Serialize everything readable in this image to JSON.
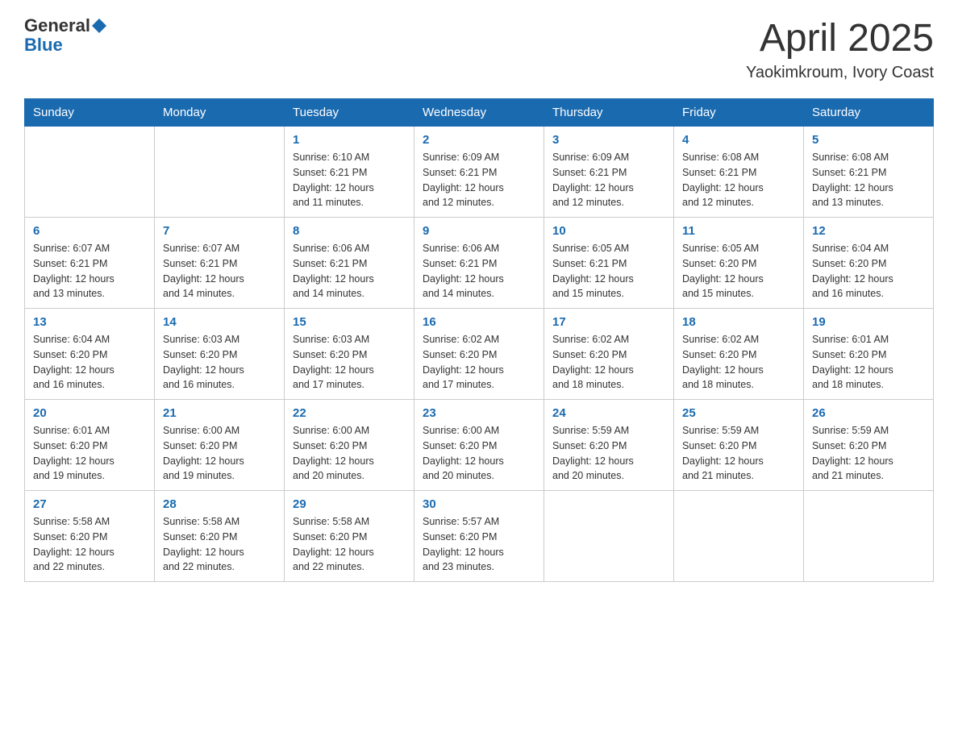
{
  "logo": {
    "general": "General",
    "blue": "Blue"
  },
  "title": "April 2025",
  "subtitle": "Yaokimkroum, Ivory Coast",
  "weekdays": [
    "Sunday",
    "Monday",
    "Tuesday",
    "Wednesday",
    "Thursday",
    "Friday",
    "Saturday"
  ],
  "weeks": [
    [
      {
        "day": "",
        "info": ""
      },
      {
        "day": "",
        "info": ""
      },
      {
        "day": "1",
        "info": "Sunrise: 6:10 AM\nSunset: 6:21 PM\nDaylight: 12 hours\nand 11 minutes."
      },
      {
        "day": "2",
        "info": "Sunrise: 6:09 AM\nSunset: 6:21 PM\nDaylight: 12 hours\nand 12 minutes."
      },
      {
        "day": "3",
        "info": "Sunrise: 6:09 AM\nSunset: 6:21 PM\nDaylight: 12 hours\nand 12 minutes."
      },
      {
        "day": "4",
        "info": "Sunrise: 6:08 AM\nSunset: 6:21 PM\nDaylight: 12 hours\nand 12 minutes."
      },
      {
        "day": "5",
        "info": "Sunrise: 6:08 AM\nSunset: 6:21 PM\nDaylight: 12 hours\nand 13 minutes."
      }
    ],
    [
      {
        "day": "6",
        "info": "Sunrise: 6:07 AM\nSunset: 6:21 PM\nDaylight: 12 hours\nand 13 minutes."
      },
      {
        "day": "7",
        "info": "Sunrise: 6:07 AM\nSunset: 6:21 PM\nDaylight: 12 hours\nand 14 minutes."
      },
      {
        "day": "8",
        "info": "Sunrise: 6:06 AM\nSunset: 6:21 PM\nDaylight: 12 hours\nand 14 minutes."
      },
      {
        "day": "9",
        "info": "Sunrise: 6:06 AM\nSunset: 6:21 PM\nDaylight: 12 hours\nand 14 minutes."
      },
      {
        "day": "10",
        "info": "Sunrise: 6:05 AM\nSunset: 6:21 PM\nDaylight: 12 hours\nand 15 minutes."
      },
      {
        "day": "11",
        "info": "Sunrise: 6:05 AM\nSunset: 6:20 PM\nDaylight: 12 hours\nand 15 minutes."
      },
      {
        "day": "12",
        "info": "Sunrise: 6:04 AM\nSunset: 6:20 PM\nDaylight: 12 hours\nand 16 minutes."
      }
    ],
    [
      {
        "day": "13",
        "info": "Sunrise: 6:04 AM\nSunset: 6:20 PM\nDaylight: 12 hours\nand 16 minutes."
      },
      {
        "day": "14",
        "info": "Sunrise: 6:03 AM\nSunset: 6:20 PM\nDaylight: 12 hours\nand 16 minutes."
      },
      {
        "day": "15",
        "info": "Sunrise: 6:03 AM\nSunset: 6:20 PM\nDaylight: 12 hours\nand 17 minutes."
      },
      {
        "day": "16",
        "info": "Sunrise: 6:02 AM\nSunset: 6:20 PM\nDaylight: 12 hours\nand 17 minutes."
      },
      {
        "day": "17",
        "info": "Sunrise: 6:02 AM\nSunset: 6:20 PM\nDaylight: 12 hours\nand 18 minutes."
      },
      {
        "day": "18",
        "info": "Sunrise: 6:02 AM\nSunset: 6:20 PM\nDaylight: 12 hours\nand 18 minutes."
      },
      {
        "day": "19",
        "info": "Sunrise: 6:01 AM\nSunset: 6:20 PM\nDaylight: 12 hours\nand 18 minutes."
      }
    ],
    [
      {
        "day": "20",
        "info": "Sunrise: 6:01 AM\nSunset: 6:20 PM\nDaylight: 12 hours\nand 19 minutes."
      },
      {
        "day": "21",
        "info": "Sunrise: 6:00 AM\nSunset: 6:20 PM\nDaylight: 12 hours\nand 19 minutes."
      },
      {
        "day": "22",
        "info": "Sunrise: 6:00 AM\nSunset: 6:20 PM\nDaylight: 12 hours\nand 20 minutes."
      },
      {
        "day": "23",
        "info": "Sunrise: 6:00 AM\nSunset: 6:20 PM\nDaylight: 12 hours\nand 20 minutes."
      },
      {
        "day": "24",
        "info": "Sunrise: 5:59 AM\nSunset: 6:20 PM\nDaylight: 12 hours\nand 20 minutes."
      },
      {
        "day": "25",
        "info": "Sunrise: 5:59 AM\nSunset: 6:20 PM\nDaylight: 12 hours\nand 21 minutes."
      },
      {
        "day": "26",
        "info": "Sunrise: 5:59 AM\nSunset: 6:20 PM\nDaylight: 12 hours\nand 21 minutes."
      }
    ],
    [
      {
        "day": "27",
        "info": "Sunrise: 5:58 AM\nSunset: 6:20 PM\nDaylight: 12 hours\nand 22 minutes."
      },
      {
        "day": "28",
        "info": "Sunrise: 5:58 AM\nSunset: 6:20 PM\nDaylight: 12 hours\nand 22 minutes."
      },
      {
        "day": "29",
        "info": "Sunrise: 5:58 AM\nSunset: 6:20 PM\nDaylight: 12 hours\nand 22 minutes."
      },
      {
        "day": "30",
        "info": "Sunrise: 5:57 AM\nSunset: 6:20 PM\nDaylight: 12 hours\nand 23 minutes."
      },
      {
        "day": "",
        "info": ""
      },
      {
        "day": "",
        "info": ""
      },
      {
        "day": "",
        "info": ""
      }
    ]
  ]
}
